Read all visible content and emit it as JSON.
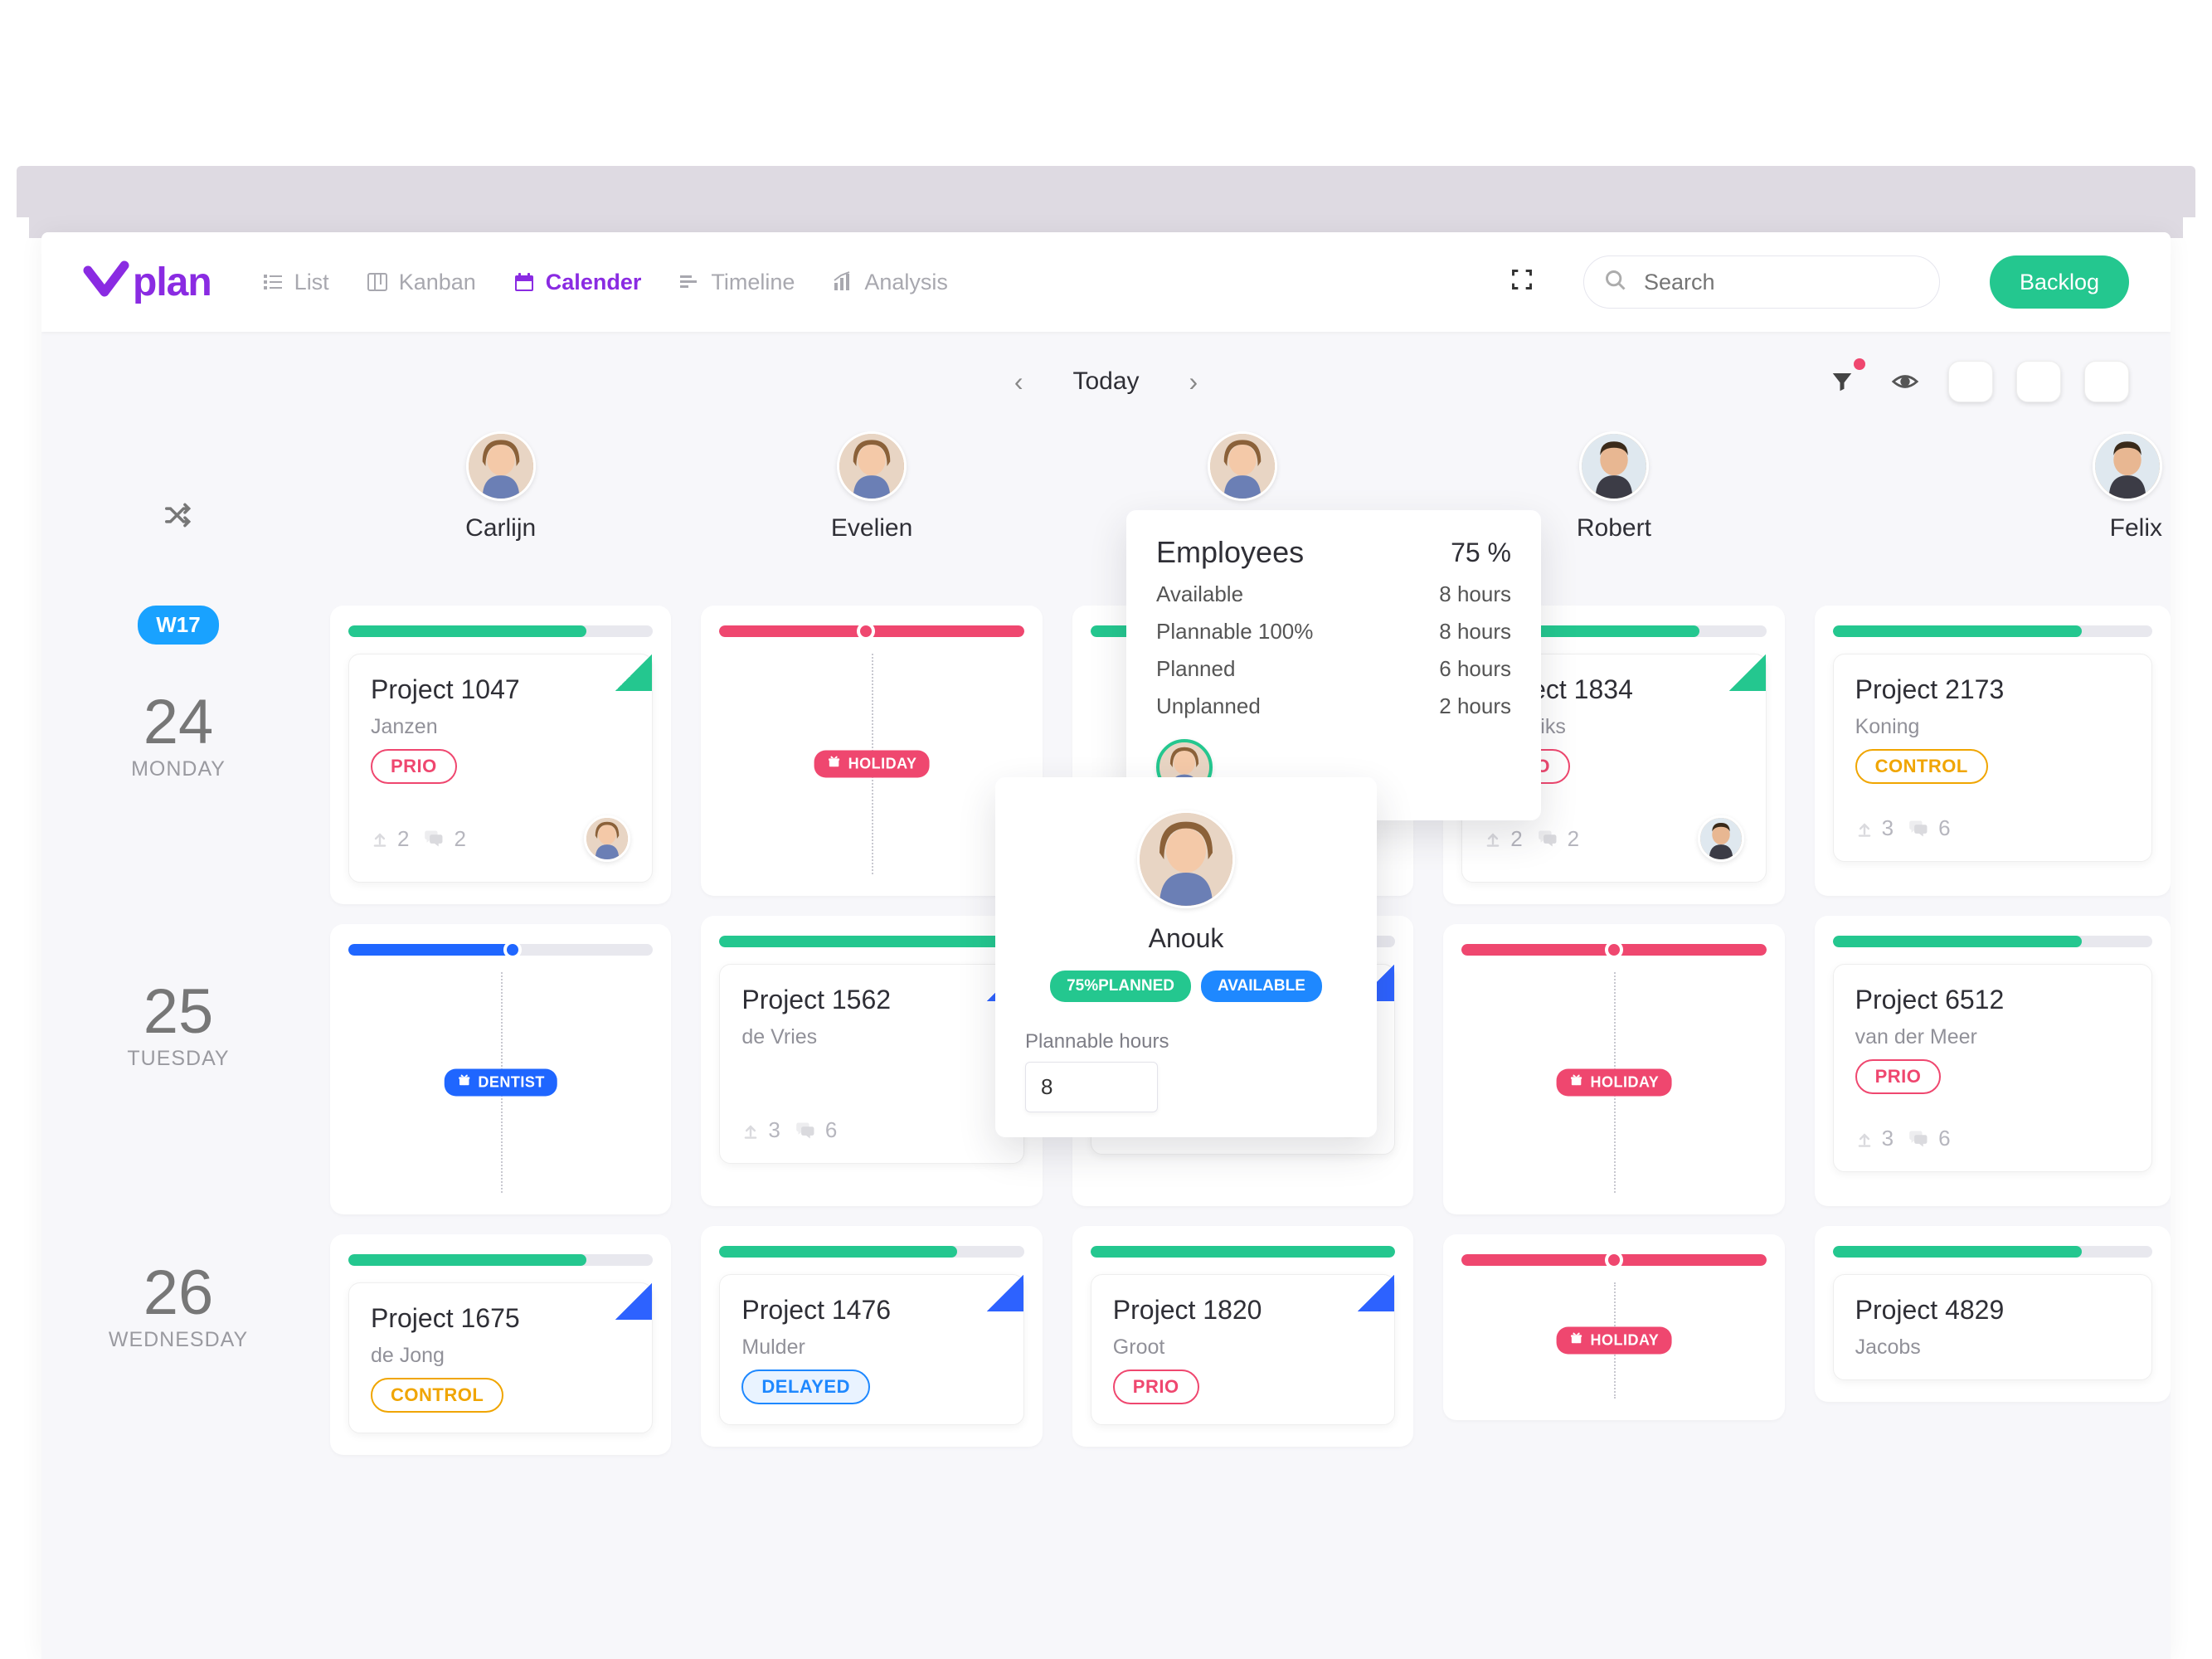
{
  "header": {
    "logo_text": "plan",
    "tabs": {
      "list": "List",
      "kanban": "Kanban",
      "calender": "Calender",
      "timeline": "Timeline",
      "analysis": "Analysis"
    },
    "search_placeholder": "Search",
    "backlog_label": "Backlog"
  },
  "subheader": {
    "prev": "‹",
    "today_label": "Today",
    "next": "›"
  },
  "columns": {
    "c0": "Carlijn",
    "c1": "Evelien",
    "c2": "Anouk",
    "c3": "Robert",
    "c4": "Felix"
  },
  "week_badge": "W17",
  "days": {
    "d0": {
      "num": "24",
      "name": "MONDAY"
    },
    "d1": {
      "num": "25",
      "name": "TUESDAY"
    },
    "d2": {
      "num": "26",
      "name": "WEDNESDAY"
    }
  },
  "chips": {
    "holiday": "HOLIDAY",
    "dentist": "DENTIST"
  },
  "cards": {
    "p1047": {
      "title": "Project 1047",
      "client": "Janzen",
      "tag": "PRIO",
      "up": "2",
      "cm": "2"
    },
    "p1834": {
      "title": "Project 1834",
      "client": "Hendriks",
      "tag": "PRIO",
      "up": "2",
      "cm": "2"
    },
    "p2173": {
      "title": "Project 2173",
      "client": "Koning",
      "tag": "CONTROL",
      "up": "3",
      "cm": "6"
    },
    "p1562": {
      "title": "Project 1562",
      "client": "de Vries",
      "up": "3",
      "cm": "6"
    },
    "p6512": {
      "title": "Project 6512",
      "client": "van der Meer",
      "tag": "PRIO",
      "up": "3",
      "cm": "6"
    },
    "p1675": {
      "title": "Project 1675",
      "client": "de Jong",
      "tag": "CONTROL"
    },
    "p1476": {
      "title": "Project 1476",
      "client": "Mulder",
      "tag": "DELAYED"
    },
    "p1820": {
      "title": "Project 1820",
      "client": "Groot",
      "tag": "PRIO"
    },
    "p4829": {
      "title": "Project 4829",
      "client": "Jacobs"
    }
  },
  "popover_employees": {
    "title": "Employees",
    "percent": "75 %",
    "rows": {
      "available": {
        "k": "Available",
        "v": "8 hours"
      },
      "plannable": {
        "k": "Plannable 100%",
        "v": "8 hours"
      },
      "planned": {
        "k": "Planned",
        "v": "6 hours"
      },
      "unplanned": {
        "k": "Unplanned",
        "v": "2 hours"
      }
    }
  },
  "popover_user": {
    "name": "Anouk",
    "pill_planned": "75%PLANNED",
    "pill_available": "AVAILABLE",
    "field_label": "Plannable hours",
    "field_value": "8"
  }
}
